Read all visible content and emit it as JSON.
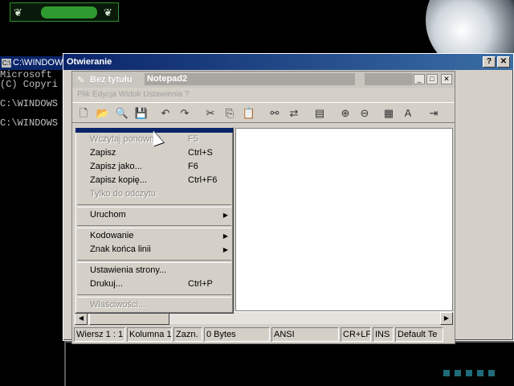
{
  "desktop": {
    "banner_text": "",
    "banner_leaf": "❦",
    "tray_count": 5
  },
  "console": {
    "title": "C:\\WINDOW",
    "icon_text": "C:\\",
    "lines": [
      "Microsoft",
      "(C) Copyri",
      "",
      "C:\\WINDOWS",
      "",
      "C:\\WINDOWS"
    ]
  },
  "dialog": {
    "title": "Otwieranie",
    "help_label": "?",
    "close_label": "✕"
  },
  "notepad": {
    "doc_title": "Bez tytułu",
    "app_title": "Notepad2",
    "menu_strip": "Plik  Edycja  Widok  Ustawienia  ?",
    "min_label": "_",
    "max_label": "□",
    "close_label": "✕",
    "toolbar_icons": [
      {
        "name": "new-icon",
        "glyph": "🗋"
      },
      {
        "name": "open-icon",
        "glyph": "📂"
      },
      {
        "name": "browse-icon",
        "glyph": "🔍"
      },
      {
        "name": "save-icon",
        "glyph": "💾"
      },
      {
        "name": "undo-icon",
        "glyph": "↶"
      },
      {
        "name": "redo-icon",
        "glyph": "↷"
      },
      {
        "name": "cut-icon",
        "glyph": "✂"
      },
      {
        "name": "copy-icon",
        "glyph": "⎘"
      },
      {
        "name": "paste-icon",
        "glyph": "📋"
      },
      {
        "name": "find-icon",
        "glyph": "⚯"
      },
      {
        "name": "replace-icon",
        "glyph": "⇄"
      },
      {
        "name": "wordwrap-icon",
        "glyph": "▤"
      },
      {
        "name": "zoom-in-icon",
        "glyph": "⊕"
      },
      {
        "name": "zoom-out-icon",
        "glyph": "⊖"
      },
      {
        "name": "schema-icon",
        "glyph": "▦"
      },
      {
        "name": "font-icon",
        "glyph": "A"
      },
      {
        "name": "exit-icon",
        "glyph": "⇥"
      }
    ],
    "status": {
      "position": "Wiersz 1 : 1",
      "column": "Kolumna 1",
      "selection": "Zazn.",
      "size": "0 Bytes",
      "encoding": "ANSI",
      "line_ending": "CR+LF",
      "insert_mode": "INS",
      "scheme": "Default Te"
    }
  },
  "file_menu": {
    "items": [
      {
        "label": "Wczytaj ponownie",
        "shortcut": "F5",
        "disabled": true
      },
      {
        "label": "Zapisz",
        "shortcut": "Ctrl+S",
        "disabled": false
      },
      {
        "label": "Zapisz jako...",
        "shortcut": "F6",
        "disabled": false
      },
      {
        "label": "Zapisz kopię...",
        "shortcut": "Ctrl+F6",
        "disabled": false
      },
      {
        "label": "Tylko do odczytu",
        "shortcut": "",
        "disabled": true
      },
      {
        "sep": true
      },
      {
        "label": "Uruchom",
        "submenu": true
      },
      {
        "sep": true
      },
      {
        "label": "Kodowanie",
        "submenu": true
      },
      {
        "label": "Znak końca linii",
        "submenu": true
      },
      {
        "sep": true
      },
      {
        "label": "Ustawienia strony...",
        "shortcut": "",
        "disabled": false
      },
      {
        "label": "Drukuj...",
        "shortcut": "Ctrl+P",
        "disabled": false
      },
      {
        "sep": true
      },
      {
        "label": "Właściwości...",
        "shortcut": "",
        "disabled": true
      }
    ]
  }
}
